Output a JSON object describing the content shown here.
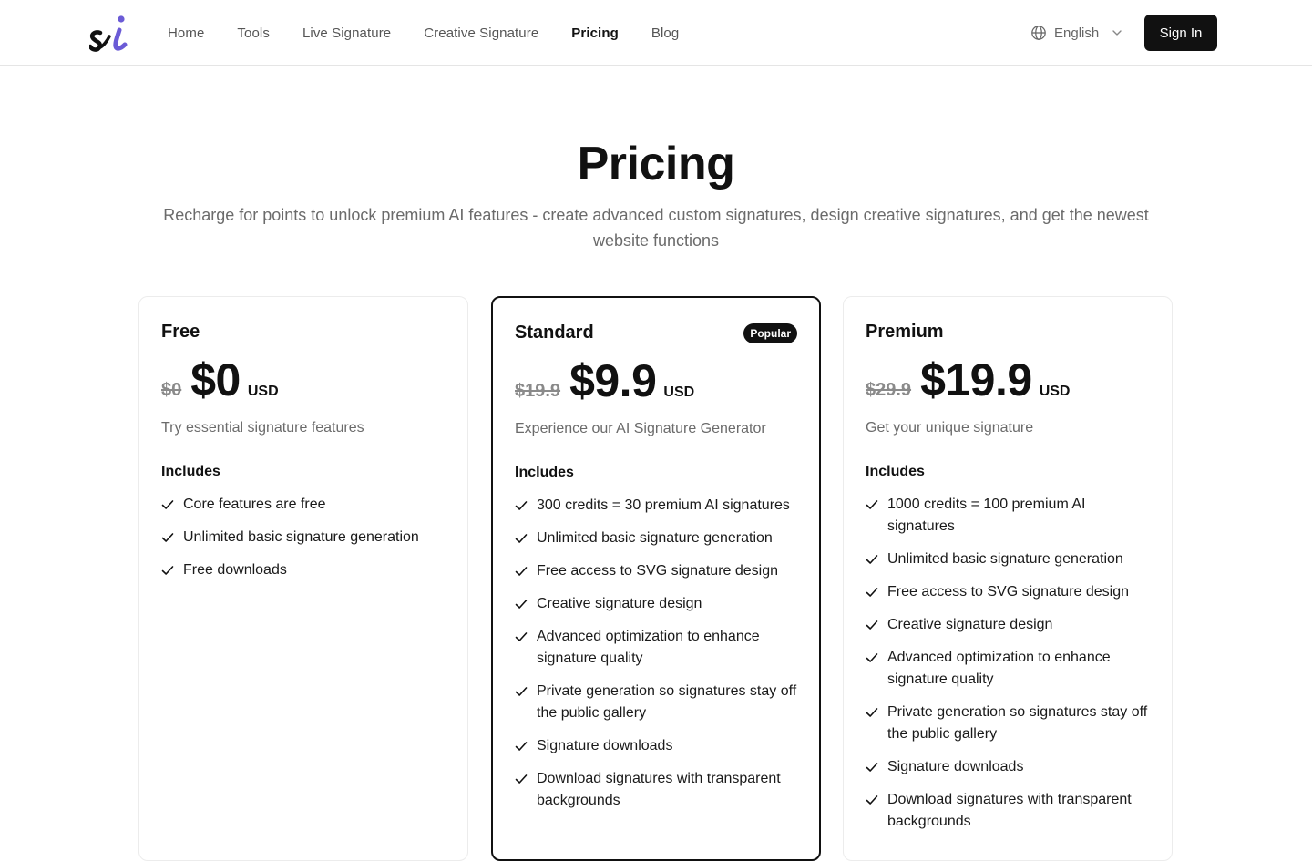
{
  "header": {
    "logo_alt": "si",
    "nav": [
      {
        "label": "Home",
        "active": false
      },
      {
        "label": "Tools",
        "active": false
      },
      {
        "label": "Live Signature",
        "active": false
      },
      {
        "label": "Creative Signature",
        "active": false
      },
      {
        "label": "Pricing",
        "active": true
      },
      {
        "label": "Blog",
        "active": false
      }
    ],
    "language": "English",
    "signin_label": "Sign In"
  },
  "hero": {
    "title": "Pricing",
    "subtitle": "Recharge for points to unlock premium AI features - create advanced custom signatures, design creative signatures, and get the newest website functions"
  },
  "plans": [
    {
      "name": "Free",
      "badge": "",
      "old_price": "$0",
      "price": "$0",
      "currency": "USD",
      "description": "Try essential signature features",
      "includes_label": "Includes",
      "features": [
        "Core features are free",
        "Unlimited basic signature generation",
        "Free downloads"
      ]
    },
    {
      "name": "Standard",
      "badge": "Popular",
      "old_price": "$19.9",
      "price": "$9.9",
      "currency": "USD",
      "description": "Experience our AI Signature Generator",
      "includes_label": "Includes",
      "features": [
        "300 credits = 30 premium AI signatures",
        "Unlimited basic signature generation",
        "Free access to SVG signature design",
        "Creative signature design",
        "Advanced optimization to enhance signature quality",
        "Private generation so signatures stay off the public gallery",
        "Signature downloads",
        "Download signatures with transparent backgrounds"
      ]
    },
    {
      "name": "Premium",
      "badge": "",
      "old_price": "$29.9",
      "price": "$19.9",
      "currency": "USD",
      "description": "Get your unique signature",
      "includes_label": "Includes",
      "features": [
        "1000 credits = 100 premium AI signatures",
        "Unlimited basic signature generation",
        "Free access to SVG signature design",
        "Creative signature design",
        "Advanced optimization to enhance signature quality",
        "Private generation so signatures stay off the public gallery",
        "Signature downloads",
        "Download signatures with transparent backgrounds"
      ]
    }
  ],
  "colors": {
    "accent": "#6b5bd6",
    "primary": "#111111",
    "muted_text": "#6b6b6b"
  },
  "icons": {
    "logo": "si-logo-icon",
    "language": "globe-icon",
    "dropdown": "chevron-down-icon",
    "feature": "check-icon"
  }
}
